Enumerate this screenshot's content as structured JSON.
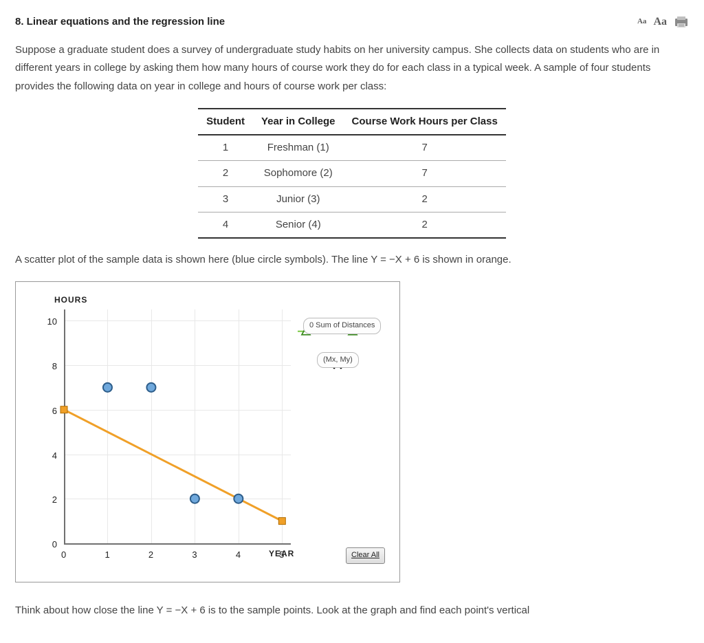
{
  "header": {
    "title": "8.  Linear equations and the regression line",
    "toolbar": {
      "font_small": "Aa",
      "font_large": "Aa",
      "print": "print-icon"
    }
  },
  "intro": "Suppose a graduate student does a survey of undergraduate study habits on her university campus. She collects data on students who are in different years in college by asking them how many hours of course work they do for each class in a typical week. A sample of four students provides the following data on year in college and hours of course work per class:",
  "table": {
    "headers": [
      "Student",
      "Year in College",
      "Course Work Hours per Class"
    ],
    "rows": [
      [
        "1",
        "Freshman (1)",
        "7"
      ],
      [
        "2",
        "Sophomore (2)",
        "7"
      ],
      [
        "3",
        "Junior (3)",
        "2"
      ],
      [
        "4",
        "Senior (4)",
        "2"
      ]
    ]
  },
  "caption": "A scatter plot of the sample data is shown here (blue circle symbols). The line Y = −X + 6 is shown in orange.",
  "chart_data": {
    "type": "scatter",
    "title": "",
    "xlabel": "YEAR",
    "ylabel": "HOURS",
    "xlim": [
      0,
      5.2
    ],
    "ylim": [
      0,
      10.5
    ],
    "x_ticks": [
      0,
      1,
      2,
      3,
      4,
      5
    ],
    "y_ticks": [
      0,
      2,
      4,
      6,
      8,
      10
    ],
    "series": [
      {
        "name": "sample points",
        "type": "scatter",
        "color": "#4a8ac9",
        "points": [
          {
            "x": 1,
            "y": 7
          },
          {
            "x": 2,
            "y": 7
          },
          {
            "x": 3,
            "y": 2
          },
          {
            "x": 4,
            "y": 2
          }
        ]
      },
      {
        "name": "Y = -X + 6",
        "type": "line",
        "color": "#f0a028",
        "points": [
          {
            "x": 0,
            "y": 6
          },
          {
            "x": 5,
            "y": 1
          }
        ]
      },
      {
        "name": "Sum of Distances",
        "type": "line",
        "color": "#7ac943",
        "points": [
          {
            "x": 6.2,
            "y": 9.5
          },
          {
            "x": 7.6,
            "y": 9.5
          }
        ]
      },
      {
        "name": "(Mx, My)",
        "type": "point",
        "color": "#000",
        "points": [
          {
            "x": 7.1,
            "y": 8.3
          }
        ]
      }
    ],
    "annotations": {
      "sum_label": "0 Sum of Distances",
      "mxmy_label": "(Mx, My)",
      "clear_button": "Clear All"
    }
  },
  "footer_text": "Think about how close the line Y = −X + 6 is to the sample points. Look at the graph and find each point's vertical"
}
